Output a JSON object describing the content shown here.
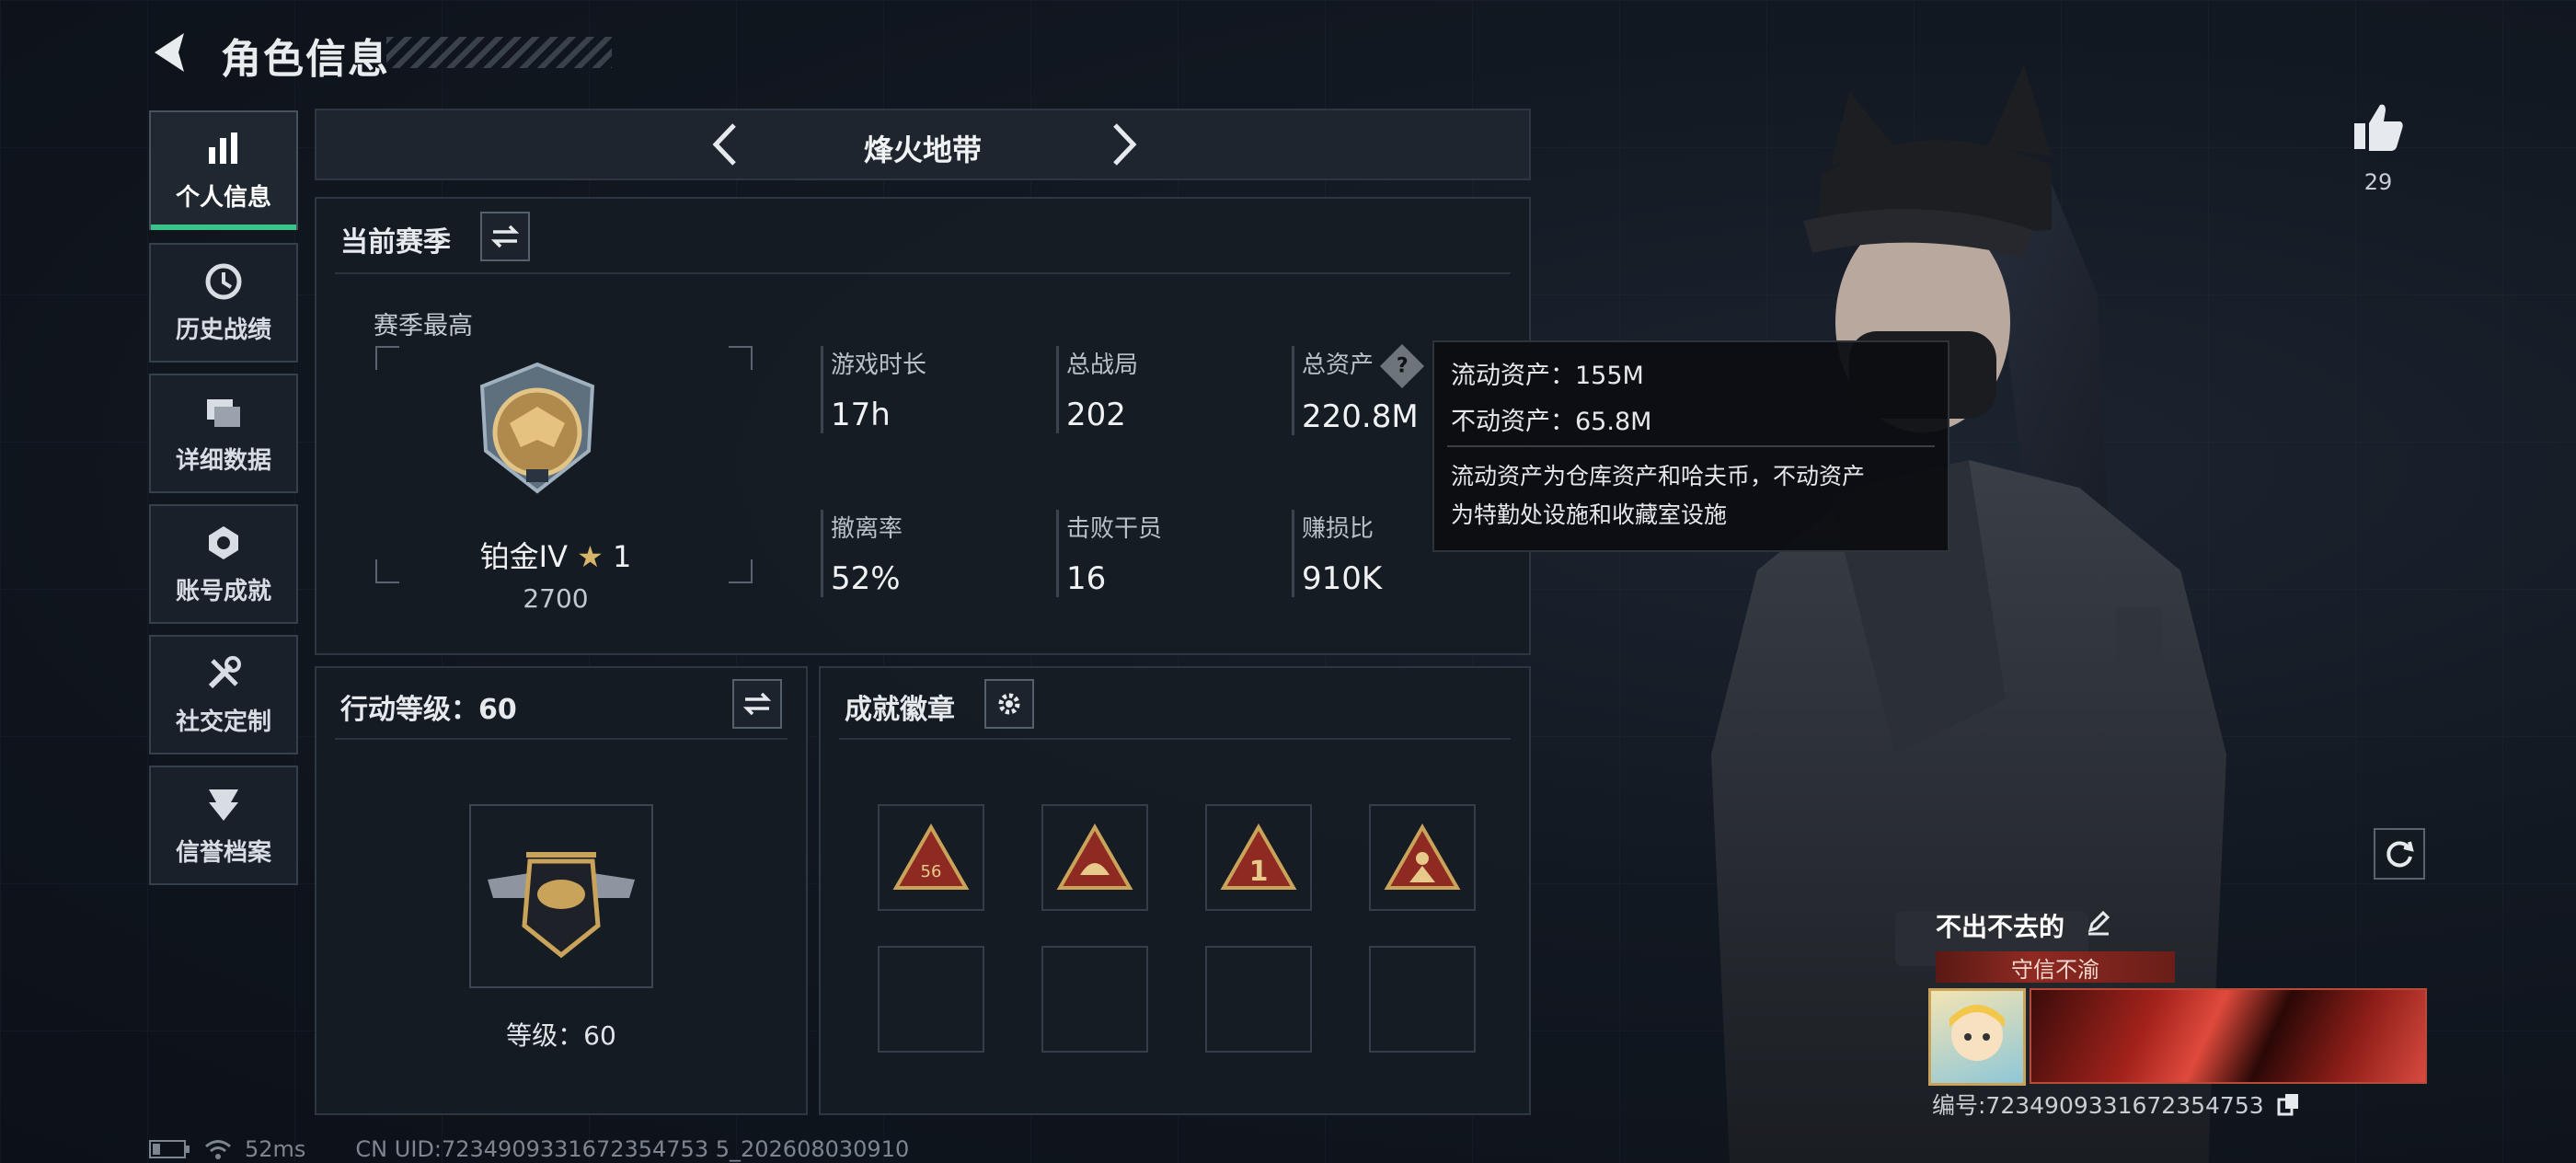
{
  "header": {
    "title": "角色信息"
  },
  "sidebar": {
    "items": [
      {
        "label": "个人信息",
        "icon": "bar-chart-icon",
        "active": true
      },
      {
        "label": "历史战绩",
        "icon": "clock-icon"
      },
      {
        "label": "详细数据",
        "icon": "folders-icon"
      },
      {
        "label": "账号成就",
        "icon": "achievement-icon"
      },
      {
        "label": "社交定制",
        "icon": "tools-icon"
      },
      {
        "label": "信誉档案",
        "icon": "emblem-icon"
      }
    ]
  },
  "mode_selector": {
    "label": "烽火地带"
  },
  "season": {
    "title": "当前赛季",
    "best_label": "赛季最高",
    "rank_name": "铂金IV",
    "rank_stars": "1",
    "rank_points": "2700",
    "stats": [
      {
        "label": "游戏时长",
        "value": "17h"
      },
      {
        "label": "总战局",
        "value": "202"
      },
      {
        "label": "总资产",
        "value": "220.8M"
      },
      {
        "label": "撤离率",
        "value": "52%"
      },
      {
        "label": "击败干员",
        "value": "16"
      },
      {
        "label": "赚损比",
        "value": "910K"
      }
    ]
  },
  "tooltip": {
    "liquid": "流动资产：155M",
    "fixed": "不动资产：65.8M",
    "desc_line1": "流动资产为仓库资产和哈夫币，不动资产",
    "desc_line2": "为特勤处设施和收藏室设施"
  },
  "action_level": {
    "title": "行动等级：60",
    "level_text": "等级：60"
  },
  "achievements": {
    "title": "成就徽章",
    "badges": [
      "56",
      "",
      "1",
      ""
    ]
  },
  "likes": {
    "count": "29"
  },
  "profile": {
    "name": "不出不去的",
    "title_tag": "守信不渝",
    "id_text": "编号:7234909331672354753"
  },
  "footer": {
    "ping": "52ms",
    "uid": "CN UID:7234909331672354753 5_202608030910"
  },
  "colors": {
    "accent": "#39c48a",
    "gold": "#c9a35a",
    "badge_red": "#8e2a22"
  }
}
